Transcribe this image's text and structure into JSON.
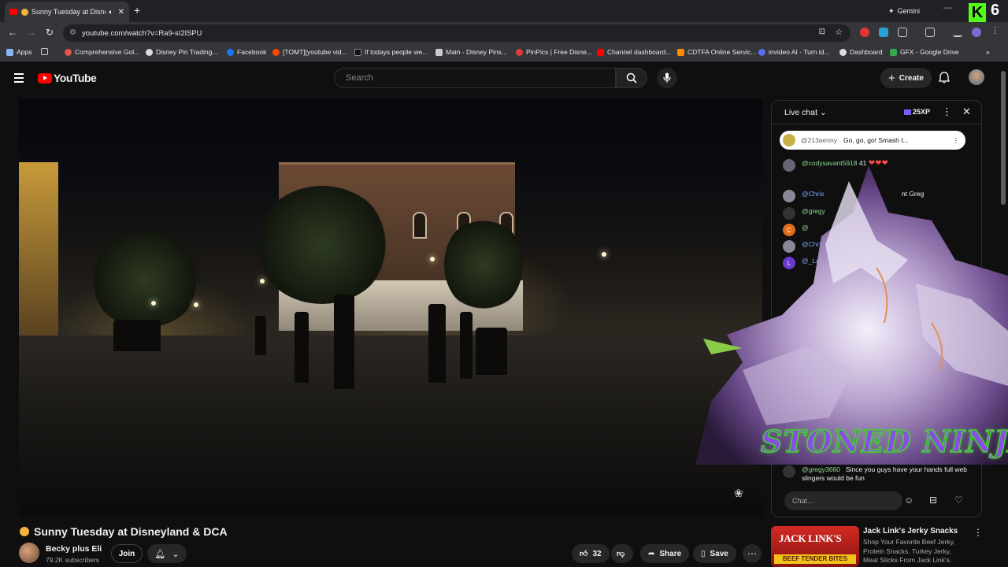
{
  "browser": {
    "tab_title": "Sunny Tuesday at Disne",
    "gemini_label": "Gemini",
    "url": "youtube.com/watch?v=Ra9-sI2lSPU",
    "badge_text": "6",
    "bookmarks": [
      {
        "label": "Apps"
      },
      {
        "label": "Comprehensive Gol..."
      },
      {
        "label": "Disney Pin Trading..."
      },
      {
        "label": "Facebook"
      },
      {
        "label": "[TOMT][youtube vid..."
      },
      {
        "label": "If todays people we..."
      },
      {
        "label": "Main - Disney Pins..."
      },
      {
        "label": "PinPics | Free Disne..."
      },
      {
        "label": "Channel dashboard..."
      },
      {
        "label": "CDTFA Online Servic..."
      },
      {
        "label": "invideo AI - Turn id..."
      },
      {
        "label": "Dashboard"
      },
      {
        "label": "GFX - Google Drive"
      }
    ]
  },
  "youtube": {
    "logo_text": "YouTube",
    "search_placeholder": "Search",
    "create_label": "Create"
  },
  "live_chat": {
    "title": "Live chat",
    "xp": "25XP",
    "pinned": {
      "author": "@213aenny",
      "message": "Go, go, go! Smash t..."
    },
    "messages": [
      {
        "author": "@codysavant5918",
        "text": "41"
      },
      {
        "author": "@Chris",
        "text": "nt Greg"
      },
      {
        "author": "@gregy",
        "text": ""
      },
      {
        "author": "@",
        "text": ""
      },
      {
        "author": "@Chris",
        "text": ""
      },
      {
        "author": "@_La",
        "text": ""
      }
    ],
    "last": {
      "author": "@gregy3660",
      "text": "Since you guys have your hands full web slingers would be fun"
    },
    "input_placeholder": "Chat..."
  },
  "overlay": {
    "text": "STONED NINJA"
  },
  "video": {
    "title": "Sunny Tuesday at Disneyland & DCA",
    "channel": "Becky plus Eli",
    "subscribers": "79.2K subscribers",
    "join_label": "Join",
    "likes": "32",
    "share_label": "Share",
    "save_label": "Save"
  },
  "ad": {
    "thumb_brand": "JACK LINK'S",
    "thumb_tag": "BEEF TENDER BITES",
    "title": "Jack Link's Jerky Snacks",
    "description": "Shop Your Favorite Beef Jerky, Protein Snacks, Turkey Jerky, Meat Sticks From Jack Link's."
  }
}
